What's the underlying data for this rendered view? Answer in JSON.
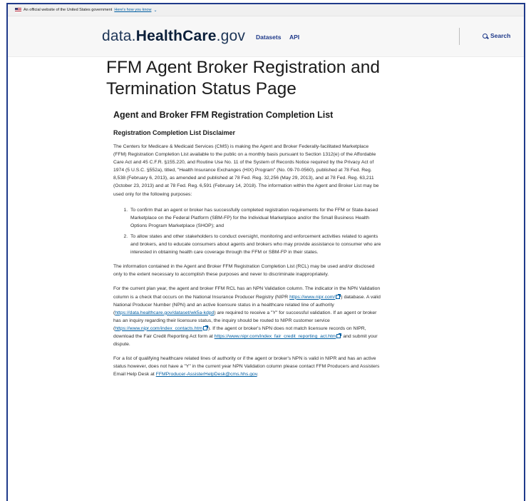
{
  "gov_banner": {
    "text": "An official website of the United States government",
    "link": "Here's how you know"
  },
  "header": {
    "logo_light": "data.",
    "logo_bold": "HealthCare",
    "logo_suffix": ".gov",
    "nav_datasets": "Datasets",
    "nav_api": "API",
    "search_label": "Search"
  },
  "page": {
    "title": "FFM Agent Broker Registration and Termination Status Page",
    "subtitle": "Agent and Broker FFM Registration Completion List",
    "disclaimer_heading": "Registration Completion List Disclaimer",
    "p1": "The Centers for Medicare & Medicaid Services (CMS) is making the Agent and Broker Federally-facilitated Marketplace (FFM) Registration Completion List available to the public on a monthly basis pursuant to Section 1312(e) of the Affordable Care Act and 45 C.F.R. §155.220, and Routine Use No. 11 of the System of Records Notice required by the Privacy Act of 1974 (5 U.S.C. §552a), titled, \"Health Insurance Exchanges (HIX) Program\" (No. 09-70-0560), published at 78 Fed. Reg. 8,538 (February 6, 2013), as amended and published at 78 Fed. Reg. 32,256 (May 29, 2013), and at 78 Fed. Reg. 63,211 (October 23, 2013) and at 78 Fed. Reg. 6,591 (February 14, 2018). The information within the Agent and Broker List may be used only for the following purposes:",
    "li1": "To confirm that an agent or broker has successfully completed registration requirements for the FFM or State-based Marketplace on the Federal Platform (SBM-FP) for the Individual Marketplace and/or the Small Business Health Options Program Marketplace (SHOP); and",
    "li2": "To allow states and other stakeholders to conduct oversight, monitoring and enforcement activities related to agents and brokers, and to educate consumers about agents and brokers who may provide assistance to consumer who are interested in obtaining health care coverage through the FFM or SBM-FP in their states.",
    "p2": "The information contained in the Agent and Broker FFM Registration Completion List (RCL) may be used and/or disclosed only to the extent necessary to accomplish these purposes and never to discriminate inappropriately.",
    "p3_a": "For the current plan year, the agent and broker FFM RCL has an NPN Validation column. The indicator in the NPN Validation column is a check that occurs on the National Insurance Producer Registry (NIPR ",
    "p3_link1": "https://www.nipr.com/",
    "p3_b": ") database. A valid National Producer Number (NPN) and an active licensure status in a healthcare related line of authority (",
    "p3_link2": "https://data.healthcare.gov/dataset/wk5a-kdpd",
    "p3_c": ") are required to receive a \"Y\" for successful validation. If an agent or broker has an inquiry regarding their licensure status, the inquiry should be routed to NIPR customer service (",
    "p3_link3": "https://www.nipr.com/index_contacts.htm",
    "p3_d": "). If the agent or broker's NPN does not match licensure records on NIPR, download the Fair Credit Reporting Act form at ",
    "p3_link4": "https://www.nipr.com/index_fair_credit_reporting_act.htm",
    "p3_e": " and submit your dispute.",
    "p4_a": "For a list of qualifying healthcare related lines of authority or if the agent or broker's NPN is valid in NIPR and has an active status however, does not have a \"Y\" in the current year NPN Validation column please contact FFM Producers and Assisters Email Help Desk at ",
    "p4_link": "FFMProducer-AssisterHelpDesk@cms.hhs.gov",
    "p4_b": "."
  },
  "colors": {
    "link": "#005ea2",
    "nav": "#1f3a8a",
    "frame": "#1f3a8a"
  }
}
